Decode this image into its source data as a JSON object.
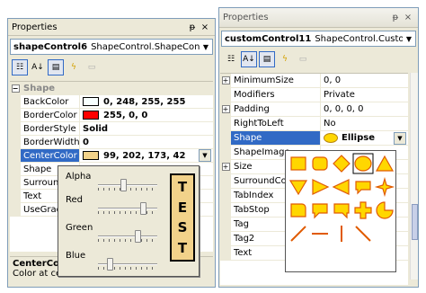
{
  "left": {
    "title": "Properties",
    "pin": "ᵽ",
    "close": "×",
    "object_name": "shapeControl6",
    "object_type": "ShapeControl.ShapeContr",
    "category": "Shape",
    "rows": [
      {
        "name": "BackColor",
        "value": "0, 248, 255, 255",
        "swatch": "#f8ffff"
      },
      {
        "name": "BorderColor",
        "value": "255, 0, 0",
        "swatch": "#ff0000"
      },
      {
        "name": "BorderStyle",
        "value": "Solid"
      },
      {
        "name": "BorderWidth",
        "value": "0"
      },
      {
        "name": "CenterColor",
        "value": "99, 202, 173, 42",
        "swatch": "#f2d28a"
      },
      {
        "name": "Shape",
        "value": ""
      },
      {
        "name": "Surroun",
        "value": ""
      },
      {
        "name": "Text",
        "value": ""
      },
      {
        "name": "UseGrad",
        "value": ""
      }
    ],
    "desc_title": "CenterColor",
    "desc_text": "Color at cent"
  },
  "color_editor": {
    "sliders": [
      {
        "label": "Alpha",
        "level": 0.42
      },
      {
        "label": "Red",
        "level": 0.78
      },
      {
        "label": "Green",
        "level": 0.68
      },
      {
        "label": "Blue",
        "level": 0.16
      }
    ],
    "test_letters": [
      "T",
      "E",
      "S",
      "T"
    ]
  },
  "right": {
    "title": "Properties",
    "pin": "ᵽ",
    "close": "×",
    "object_name": "customControl11",
    "object_type": "ShapeControl.CustomCo",
    "rows": [
      {
        "expand": "+",
        "name": "MinimumSize",
        "value": "0, 0"
      },
      {
        "expand": "",
        "name": "Modifiers",
        "value": "Private"
      },
      {
        "expand": "+",
        "name": "Padding",
        "value": "0, 0, 0, 0"
      },
      {
        "expand": "",
        "name": "RightToLeft",
        "value": "No"
      },
      {
        "expand": "",
        "name": "Shape",
        "value": "Ellipse",
        "selected": true
      },
      {
        "expand": "",
        "name": "ShapeImage",
        "value": ""
      },
      {
        "expand": "+",
        "name": "Size",
        "value": ""
      },
      {
        "expand": "",
        "name": "SurroundCol",
        "value": ""
      },
      {
        "expand": "",
        "name": "TabIndex",
        "value": ""
      },
      {
        "expand": "",
        "name": "TabStop",
        "value": ""
      },
      {
        "expand": "",
        "name": "Tag",
        "value": ""
      },
      {
        "expand": "",
        "name": "Tag2",
        "value": ""
      },
      {
        "expand": "",
        "name": "Text",
        "value": ""
      }
    ]
  },
  "shape_picker": {
    "fill": "#ffd700",
    "stroke": "#e05a00",
    "shapes": [
      "rectangle",
      "rounded-rectangle",
      "diamond",
      "ellipse",
      "triangle-up",
      "triangle-down",
      "triangle-right",
      "triangle-left",
      "balloon",
      "star",
      "rounded-tab",
      "speech-bubble-left",
      "speech-bubble-right",
      "cross",
      "pie",
      "line-diagonal-up",
      "line-horizontal",
      "line-vertical",
      "line-diagonal-down"
    ]
  }
}
